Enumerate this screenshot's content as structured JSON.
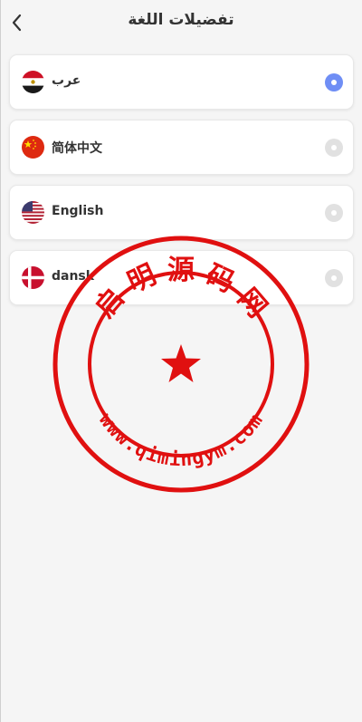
{
  "header": {
    "title": "تفضيلات اللغة",
    "back_icon": "chevron-left-icon"
  },
  "languages": [
    {
      "label": "عرب",
      "flag": "egypt-flag-icon",
      "selected": true
    },
    {
      "label": "简体中文",
      "flag": "china-flag-icon",
      "selected": false
    },
    {
      "label": "English",
      "flag": "usa-flag-icon",
      "selected": false
    },
    {
      "label": "dansk",
      "flag": "denmark-flag-icon",
      "selected": false
    }
  ],
  "watermark": {
    "top_text": "启 明 源 码 网",
    "bottom_text": "www.qimingym.com"
  },
  "colors": {
    "accent": "#6f8ef5",
    "radio_off": "#e1e1e1",
    "stamp_red": "#e01010"
  }
}
